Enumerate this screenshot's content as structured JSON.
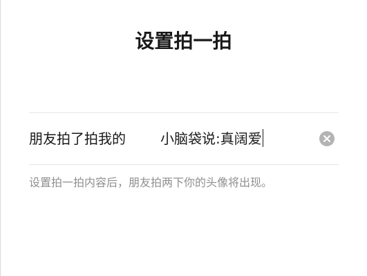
{
  "header": {
    "title": "设置拍一拍"
  },
  "pat_field": {
    "prefix": "朋友拍了拍我的",
    "value": "小脑袋说:真阔爱",
    "clear_icon": "clear-circle-icon"
  },
  "hint": {
    "text": "设置拍一拍内容后，朋友拍两下你的头像将出现。"
  },
  "colors": {
    "text_primary": "#191919",
    "text_hint": "#8f8f8f",
    "divider": "#e6e6e6",
    "clear_icon_bg": "#b3b3b3"
  }
}
